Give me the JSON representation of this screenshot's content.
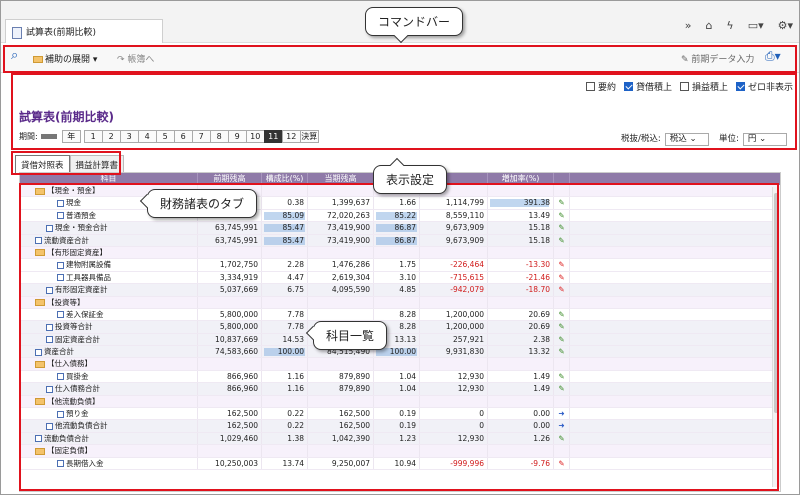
{
  "window": {
    "tab_title": "試算表(前期比較)"
  },
  "toolbar": {
    "expand_label": "補助の展開",
    "back_label": "帳簿へ",
    "prev_input_label": "前期データ入力"
  },
  "options": {
    "items": [
      {
        "label": "要約",
        "on": false
      },
      {
        "label": "貸借積上",
        "on": true
      },
      {
        "label": "損益積上",
        "on": false
      },
      {
        "label": "ゼロ非表示",
        "on": true
      }
    ]
  },
  "report": {
    "title": "試算表(前期比較)",
    "period_label": "期間:",
    "year_label": "年",
    "periods": [
      "1",
      "2",
      "3",
      "4",
      "5",
      "6",
      "7",
      "8",
      "9",
      "10",
      "11",
      "12",
      "決算"
    ],
    "selected_period": "11",
    "tax_label": "税抜/税込:",
    "tax_value": "税込",
    "unit_label": "単位:",
    "unit_value": "円"
  },
  "statement_tabs": [
    "貸借対照表",
    "損益計算書"
  ],
  "columns": [
    "科目",
    "前期残高",
    "構成比(%)",
    "当期残高",
    "構成比(%)",
    "",
    "増加率(%)",
    ""
  ],
  "rows": [
    {
      "name": "【現金・預金】",
      "type": "grp",
      "indent": 1
    },
    {
      "name": "現金",
      "indent": 3,
      "prev": "",
      "r1": "0.38",
      "cur": "1,399,637",
      "r2": "1.66",
      "inc": "1,114,799",
      "rate": "391.38",
      "icon": "pen",
      "b1": 0,
      "b2": 0,
      "b3": 1
    },
    {
      "name": "普通預金",
      "indent": 3,
      "prev": "",
      "r1": "85.09",
      "cur": "72,020,263",
      "r2": "85.22",
      "inc": "8,559,110",
      "rate": "13.49",
      "icon": "pen",
      "b1": 1,
      "b2": 1,
      "b3": 0
    },
    {
      "name": "現金・預金合計",
      "type": "sub",
      "indent": 2,
      "prev": "63,745,991",
      "r1": "85.47",
      "cur": "73,419,900",
      "r2": "86.87",
      "inc": "9,673,909",
      "rate": "15.18",
      "icon": "pen",
      "b1": 1,
      "b2": 1,
      "b3": 0
    },
    {
      "name": "流動資産合計",
      "type": "sub",
      "indent": 1,
      "prev": "63,745,991",
      "r1": "85.47",
      "cur": "73,419,900",
      "r2": "86.87",
      "inc": "9,673,909",
      "rate": "15.18",
      "icon": "pen",
      "b1": 1,
      "b2": 1,
      "b3": 0
    },
    {
      "name": "【有形固定資産】",
      "type": "grp",
      "indent": 1
    },
    {
      "name": "建物附属設備",
      "indent": 3,
      "prev": "1,702,750",
      "r1": "2.28",
      "cur": "1,476,286",
      "r2": "1.75",
      "inc": "-226,464",
      "rate": "-13.30",
      "icon": "pen-red",
      "neg": true
    },
    {
      "name": "工具器具備品",
      "indent": 3,
      "prev": "3,334,919",
      "r1": "4.47",
      "cur": "2,619,304",
      "r2": "3.10",
      "inc": "-715,615",
      "rate": "-21.46",
      "icon": "pen-red",
      "neg": true
    },
    {
      "name": "有形固定資産計",
      "type": "sub",
      "indent": 2,
      "prev": "5,037,669",
      "r1": "6.75",
      "cur": "4,095,590",
      "r2": "4.85",
      "inc": "-942,079",
      "rate": "-18.70",
      "icon": "pen-red",
      "neg": true
    },
    {
      "name": "【投資等】",
      "type": "grp",
      "indent": 1
    },
    {
      "name": "差入保証金",
      "indent": 3,
      "prev": "5,800,000",
      "r1": "7.78",
      "cur": "",
      "r2": "8.28",
      "inc": "1,200,000",
      "rate": "20.69",
      "icon": "pen"
    },
    {
      "name": "投資等合計",
      "type": "sub",
      "indent": 2,
      "prev": "5,800,000",
      "r1": "7.78",
      "cur": "",
      "r2": "8.28",
      "inc": "1,200,000",
      "rate": "20.69",
      "icon": "pen"
    },
    {
      "name": "固定資産合計",
      "type": "sub",
      "indent": 2,
      "prev": "10,837,669",
      "r1": "14.53",
      "cur": "",
      "r2": "13.13",
      "inc": "257,921",
      "rate": "2.38",
      "icon": "pen"
    },
    {
      "name": "資産合計",
      "type": "sub",
      "indent": 1,
      "prev": "74,583,660",
      "r1": "100.00",
      "cur": "84,515,490",
      "r2": "100.00",
      "inc": "9,931,830",
      "rate": "13.32",
      "icon": "pen",
      "b1": 1,
      "b2": 1,
      "b3": 0
    },
    {
      "name": "【仕入債務】",
      "type": "grp",
      "indent": 1
    },
    {
      "name": "買掛金",
      "indent": 3,
      "prev": "866,960",
      "r1": "1.16",
      "cur": "879,890",
      "r2": "1.04",
      "inc": "12,930",
      "rate": "1.49",
      "icon": "pen"
    },
    {
      "name": "仕入債務合計",
      "type": "sub",
      "indent": 2,
      "prev": "866,960",
      "r1": "1.16",
      "cur": "879,890",
      "r2": "1.04",
      "inc": "12,930",
      "rate": "1.49",
      "icon": "pen"
    },
    {
      "name": "【他流動負債】",
      "type": "grp",
      "indent": 1
    },
    {
      "name": "預り金",
      "indent": 3,
      "prev": "162,500",
      "r1": "0.22",
      "cur": "162,500",
      "r2": "0.19",
      "inc": "0",
      "rate": "0.00",
      "icon": "arrow"
    },
    {
      "name": "他流動負債合計",
      "type": "sub",
      "indent": 2,
      "prev": "162,500",
      "r1": "0.22",
      "cur": "162,500",
      "r2": "0.19",
      "inc": "0",
      "rate": "0.00",
      "icon": "arrow"
    },
    {
      "name": "流動負債合計",
      "type": "sub",
      "indent": 1,
      "prev": "1,029,460",
      "r1": "1.38",
      "cur": "1,042,390",
      "r2": "1.23",
      "inc": "12,930",
      "rate": "1.26",
      "icon": "pen"
    },
    {
      "name": "【固定負債】",
      "type": "grp",
      "indent": 1
    },
    {
      "name": "長期借入金",
      "indent": 3,
      "prev": "10,250,003",
      "r1": "13.74",
      "cur": "9,250,007",
      "r2": "10.94",
      "inc": "-999,996",
      "rate": "-9.76",
      "icon": "pen-red",
      "neg": true
    }
  ],
  "callouts": {
    "command_bar": "コマンドバー",
    "display_settings": "表示設定",
    "statement_tab": "財務諸表のタブ",
    "account_list": "科目一覧"
  }
}
